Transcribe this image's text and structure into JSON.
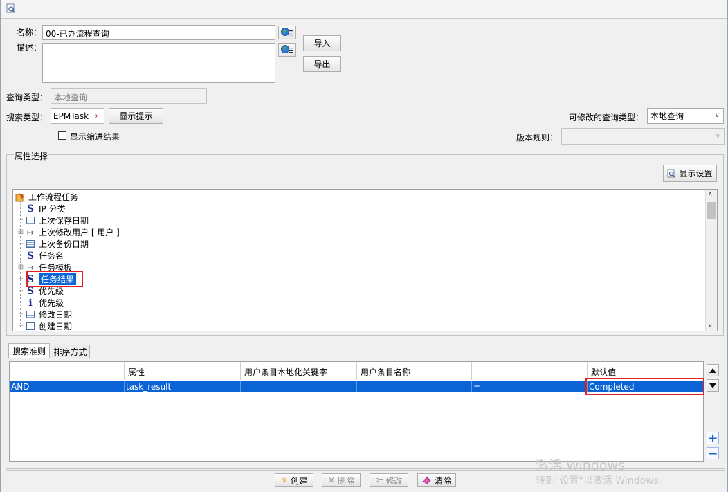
{
  "form": {
    "name_label": "名称：",
    "name_value": "00-已办流程查询",
    "desc_label": "描述：",
    "desc_value": "",
    "import_label": "导入",
    "export_label": "导出",
    "query_type_label": "查询类型：",
    "query_type_value": "本地查询",
    "search_type_label": "搜索类型：",
    "search_type_value": "EPMTask",
    "show_hint_label": "显示提示",
    "modifiable_query_type_label": "可修改的查询类型：",
    "modifiable_query_type_value": "本地查询",
    "show_indented_label": "显示缩进结果",
    "show_indented_checked": false,
    "revision_rule_label": "版本规则：",
    "revision_rule_value": ""
  },
  "attributes": {
    "section_title": "属性选择",
    "display_settings_label": "显示设置",
    "tree": {
      "root": "工作流程任务",
      "items": [
        {
          "label": "IP 分类",
          "icon": "string-icon",
          "expandable": false
        },
        {
          "label": "上次保存日期",
          "icon": "calendar-icon",
          "expandable": false
        },
        {
          "label": "上次修改用户 [ 用户 ]",
          "icon": "reference-icon",
          "expandable": true
        },
        {
          "label": "上次备份日期",
          "icon": "calendar-icon",
          "expandable": false
        },
        {
          "label": "任务名",
          "icon": "string-icon",
          "expandable": false
        },
        {
          "label": "任务模板",
          "icon": "arrow-icon",
          "expandable": true
        },
        {
          "label": "任务结果",
          "icon": "string-icon",
          "expandable": false,
          "selected": true
        },
        {
          "label": "优先级",
          "icon": "string-icon",
          "expandable": false
        },
        {
          "label": "优先级",
          "icon": "integer-icon",
          "expandable": false
        },
        {
          "label": "修改日期",
          "icon": "calendar-icon",
          "expandable": false
        },
        {
          "label": "创建日期",
          "icon": "calendar-icon",
          "expandable": false
        }
      ]
    }
  },
  "criteria": {
    "tabs": [
      {
        "label": "搜索准则",
        "active": true
      },
      {
        "label": "排序方式",
        "active": false
      }
    ],
    "columns": [
      "",
      "属性",
      "用户条目本地化关键字",
      "用户条目名称",
      "",
      "默认值"
    ],
    "rows": [
      {
        "logic": "AND",
        "attribute": "task_result",
        "localized_key": "",
        "display_name": "",
        "operator": "=",
        "default_value": "Completed",
        "selected": true
      }
    ]
  },
  "footer": {
    "create_label": "创建",
    "delete_label": "删除",
    "modify_label": "修改",
    "clear_label": "清除"
  },
  "watermark": {
    "line1": "激活 Windows",
    "line2": "转到\"设置\"以激活 Windows。"
  },
  "colors": {
    "selection": "#0a64d6",
    "highlight_box": "#e02222"
  }
}
